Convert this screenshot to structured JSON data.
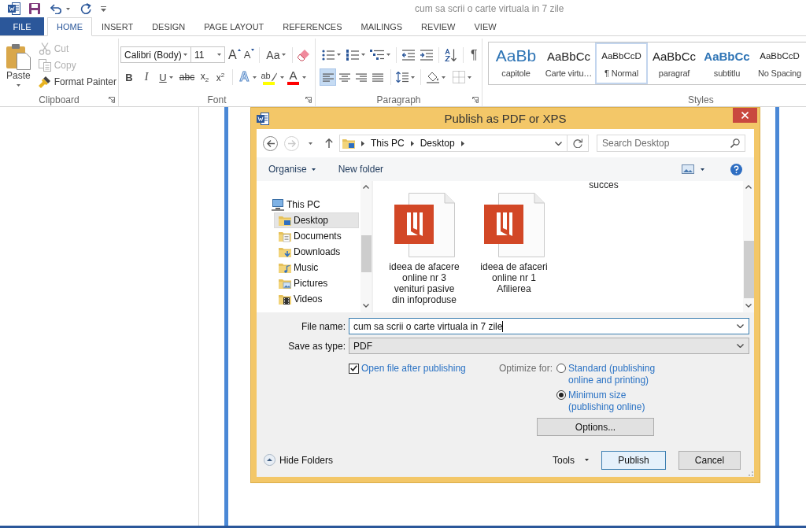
{
  "title_bar": {
    "title": "cum sa scrii o carte virtuala in 7 zile"
  },
  "tabs": [
    {
      "label": "FILE",
      "kind": "backstage",
      "selected": false
    },
    {
      "label": "HOME",
      "kind": "tab",
      "selected": true
    },
    {
      "label": "INSERT",
      "kind": "tab",
      "selected": false
    },
    {
      "label": "DESIGN",
      "kind": "tab",
      "selected": false
    },
    {
      "label": "PAGE LAYOUT",
      "kind": "tab",
      "selected": false
    },
    {
      "label": "REFERENCES",
      "kind": "tab",
      "selected": false
    },
    {
      "label": "MAILINGS",
      "kind": "tab",
      "selected": false
    },
    {
      "label": "REVIEW",
      "kind": "tab",
      "selected": false
    },
    {
      "label": "VIEW",
      "kind": "tab",
      "selected": false
    }
  ],
  "ribbon": {
    "clipboard": {
      "label": "Clipboard",
      "paste": "Paste",
      "items": [
        {
          "kind": "cut",
          "label": "Cut",
          "disabled": true
        },
        {
          "kind": "copy",
          "label": "Copy",
          "disabled": true
        },
        {
          "kind": "painter",
          "label": "Format Painter",
          "disabled": false
        }
      ]
    },
    "font": {
      "label": "Font",
      "font_name": "Calibri (Body)",
      "font_size": "11",
      "size_buttons": [
        {
          "kind": "grow",
          "label": "A"
        },
        {
          "kind": "shrink",
          "label": "A"
        }
      ],
      "change_case": "Aa",
      "format_buttons": [
        {
          "kind": "bold",
          "label": "B"
        },
        {
          "kind": "italic",
          "label": "I"
        },
        {
          "kind": "underline",
          "label": "U"
        },
        {
          "kind": "strike",
          "label": "abc"
        },
        {
          "kind": "sub",
          "label": "x$_{2}$"
        },
        {
          "kind": "sup",
          "label": "x$^{2}$"
        }
      ],
      "color_buttons": [
        {
          "kind": "effects",
          "label": "A"
        },
        {
          "kind": "highlight",
          "label": "ab",
          "color": "#ffff00"
        },
        {
          "kind": "font-color",
          "label": "A",
          "color": "#ff0000"
        }
      ]
    },
    "paragraph": {
      "label": "Paragraph",
      "show_marks": "¶",
      "alignment": [
        {
          "kind": "left",
          "selected": true
        },
        {
          "kind": "center",
          "selected": false
        },
        {
          "kind": "right",
          "selected": false
        },
        {
          "kind": "justify",
          "selected": false
        }
      ]
    },
    "styles": {
      "label": "Styles",
      "items": [
        {
          "kind": "heading",
          "preview": "AaBb",
          "name": "capitole",
          "selected": false
        },
        {
          "kind": "plain",
          "preview": "AaBbCc",
          "name": "Carte virtu…",
          "selected": false
        },
        {
          "kind": "small",
          "preview": "AaBbCcD",
          "name": "¶ Normal",
          "selected": true
        },
        {
          "kind": "plain",
          "preview": "AaBbCc",
          "name": "paragraf",
          "selected": false
        },
        {
          "kind": "subtitle",
          "preview": "AaBbCc",
          "name": "subtitlu",
          "selected": false
        },
        {
          "kind": "small",
          "preview": "AaBbCcD",
          "name": "No Spacing",
          "selected": false
        }
      ]
    }
  },
  "dialog": {
    "title": "Publish as PDF or XPS",
    "history": [
      {
        "kind": "back",
        "disabled": false
      },
      {
        "kind": "forward",
        "disabled": true
      }
    ],
    "breadcrumbs": [
      "This PC",
      "Desktop"
    ],
    "search": {
      "placeholder": "Search Desktop"
    },
    "commands": [
      "Organise",
      "New folder"
    ],
    "nav": [
      {
        "label": "This PC",
        "kind": "pc",
        "selected": false,
        "children": [
          {
            "label": "Desktop",
            "kind": "desktop",
            "selected": true
          },
          {
            "label": "Documents",
            "kind": "documents",
            "selected": false
          },
          {
            "label": "Downloads",
            "kind": "downloads",
            "selected": false
          },
          {
            "label": "Music",
            "kind": "music",
            "selected": false
          },
          {
            "label": "Pictures",
            "kind": "pictures",
            "selected": false
          },
          {
            "label": "Videos",
            "kind": "videos",
            "selected": false
          }
        ]
      }
    ],
    "files": [
      {
        "name": "succes",
        "kind": "partial"
      },
      {
        "name": "ideea de afacere online nr 3 venituri pasive din infoproduse",
        "kind": "pdf"
      },
      {
        "name": "ideea de afaceri online nr 1 Afilierea",
        "kind": "pdf"
      }
    ],
    "file_name": {
      "label": "File name:",
      "value": "cum sa scrii o carte virtuala in 7 zile"
    },
    "save_type": {
      "label": "Save as type:",
      "value": "PDF"
    },
    "open_after": {
      "label": "Open file after publishing",
      "checked": true
    },
    "optimize": {
      "label": "Optimize for:",
      "options": [
        {
          "label": "Standard (publishing online and printing)",
          "selected": false
        },
        {
          "label": "Minimum size (publishing online)",
          "selected": true
        }
      ]
    },
    "options_button": "Options...",
    "hide_folders": "Hide Folders",
    "tools": "Tools",
    "buttons": [
      {
        "label": "Publish",
        "default": true
      },
      {
        "label": "Cancel",
        "default": false
      }
    ]
  }
}
